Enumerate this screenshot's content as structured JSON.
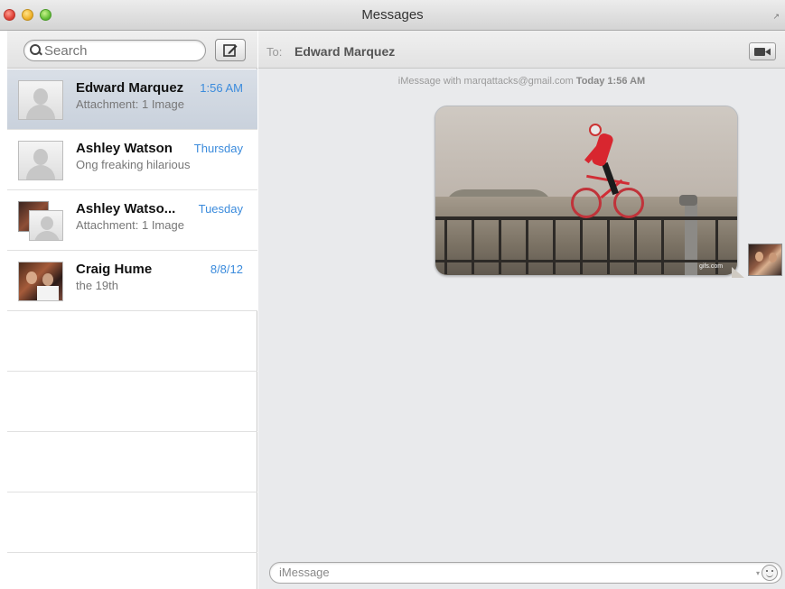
{
  "window": {
    "title": "Messages"
  },
  "sidebar": {
    "search_placeholder": "Search",
    "conversations": [
      {
        "name": "Edward Marquez",
        "time": "1:56 AM",
        "preview": "Attachment: 1 Image",
        "selected": true,
        "avatar": "person-placeholder-icon"
      },
      {
        "name": "Ashley Watson",
        "time": "Thursday",
        "preview": "Ong freaking hilarious",
        "selected": false,
        "avatar": "person-placeholder-icon"
      },
      {
        "name": "Ashley Watso...",
        "time": "Tuesday",
        "preview": "Attachment: 1 Image",
        "selected": false,
        "avatar": "group-avatar-icon"
      },
      {
        "name": "Craig Hume",
        "time": "8/8/12",
        "preview": "the 19th",
        "selected": false,
        "avatar": "photo-avatar"
      }
    ]
  },
  "main": {
    "to_label": "To:",
    "recipient": "Edward Marquez",
    "info_text": "iMessage with marqattacks@gmail.com",
    "info_time": "Today 1:56 AM",
    "attachment_watermark": "gifs.com",
    "input_placeholder": "iMessage"
  },
  "colors": {
    "accent_time": "#3b8bdc",
    "selected_row": "#cfd6e0",
    "chat_background": "#e9eaec"
  }
}
